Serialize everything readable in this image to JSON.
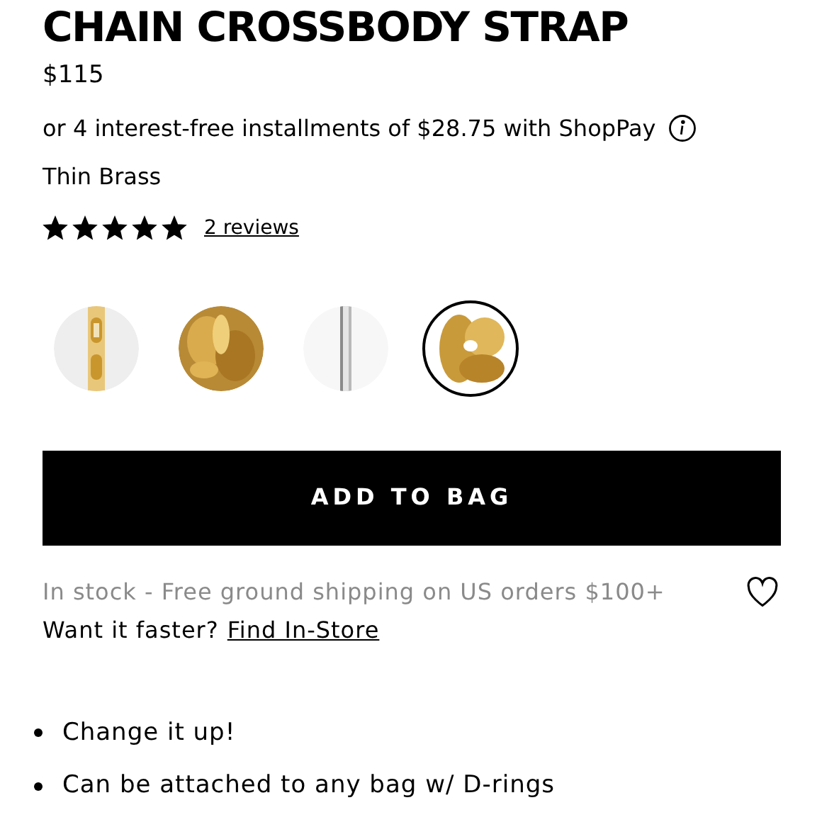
{
  "product": {
    "title": "CHAIN CROSSBODY STRAP",
    "price": "$115",
    "installments": "or 4 interest-free installments of $28.75 with ShopPay",
    "variant": "Thin Brass",
    "stars": 5,
    "reviews_link": "2 reviews"
  },
  "swatches": [
    {
      "kind": "picture",
      "selected": false
    },
    {
      "kind": "picture",
      "selected": false
    },
    {
      "kind": "picture",
      "selected": false
    },
    {
      "kind": "picture",
      "selected": true
    }
  ],
  "add_button": "ADD TO BAG",
  "shipping": "In stock - Free ground shipping on US orders $100+",
  "pickup": {
    "text": "Want it faster?",
    "link": "Find In-Store"
  },
  "features": [
    "Change it up!",
    "Can be attached to any bag w/ D-rings"
  ]
}
